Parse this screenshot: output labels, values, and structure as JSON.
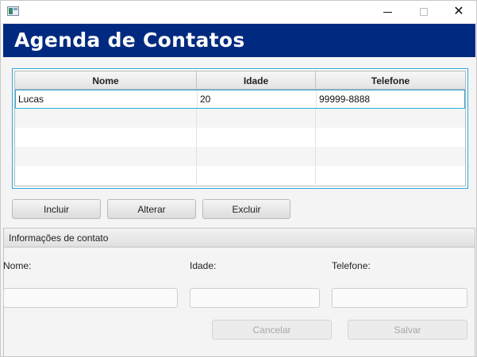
{
  "window": {
    "icon": "app-window-icon",
    "controls": {
      "minimize": "minimize-icon",
      "maximize": "maximize-icon",
      "close": "close-icon",
      "close_glyph": "✕"
    }
  },
  "header": {
    "title": "Agenda de Contatos",
    "bg_color": "#002a7f"
  },
  "table": {
    "columns": [
      "Nome",
      "Idade",
      "Telefone"
    ],
    "rows": [
      {
        "nome": "Lucas",
        "idade": "20",
        "telefone": "99999-8888",
        "selected": true
      },
      {
        "nome": "",
        "idade": "",
        "telefone": ""
      },
      {
        "nome": "",
        "idade": "",
        "telefone": ""
      },
      {
        "nome": "",
        "idade": "",
        "telefone": ""
      },
      {
        "nome": "",
        "idade": "",
        "telefone": ""
      }
    ],
    "accent_color": "#2aa8d8"
  },
  "actions": {
    "incluir": "Incluir",
    "alterar": "Alterar",
    "excluir": "Excluir"
  },
  "contact_form": {
    "section_title": "Informações de contato",
    "nome_label": "Nome:",
    "idade_label": "Idade:",
    "telefone_label": "Telefone:",
    "nome_value": "",
    "idade_value": "",
    "telefone_value": "",
    "cancelar": "Cancelar",
    "salvar": "Salvar"
  }
}
